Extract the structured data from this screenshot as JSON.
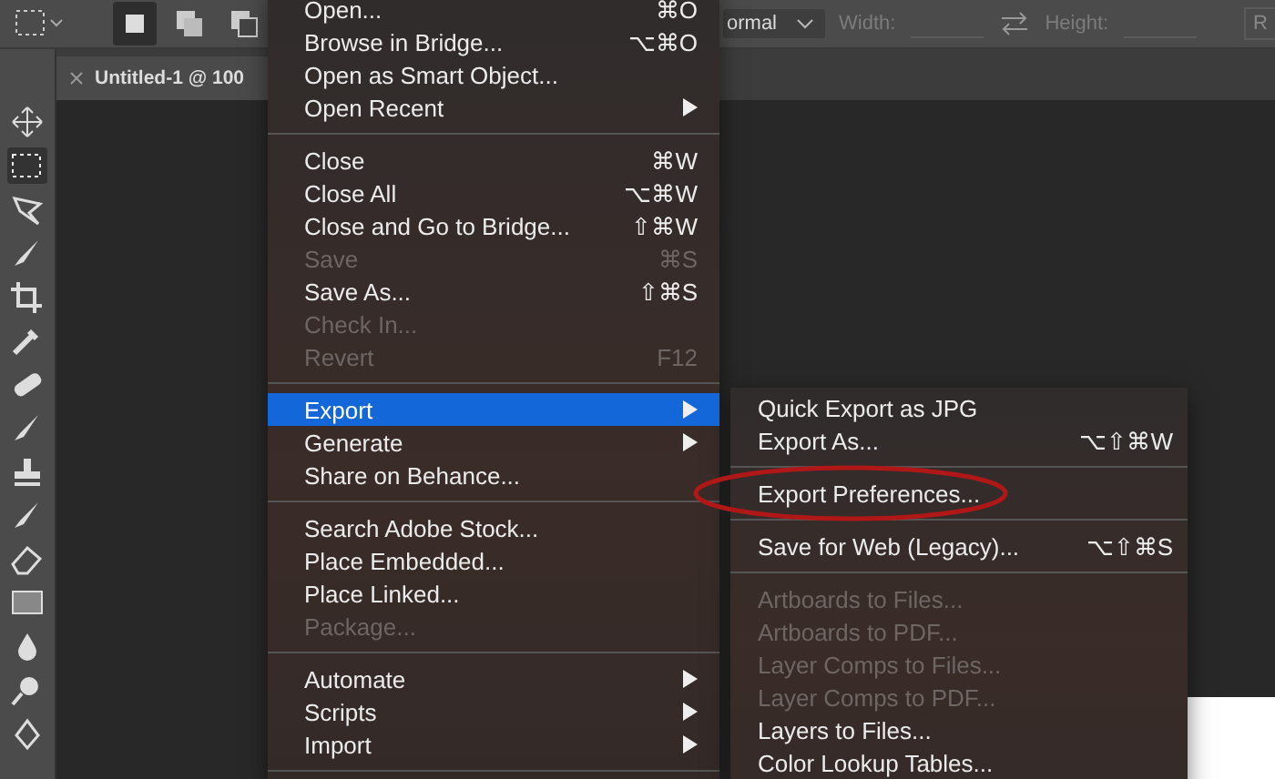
{
  "options_bar": {
    "mode": "ormal",
    "width_label": "Width:",
    "height_label": "Height:",
    "field_cut": "R"
  },
  "document_tab": {
    "title": "Untitled-1 @ 100"
  },
  "file_menu": {
    "items": [
      {
        "kind": "item",
        "label": "Open...",
        "shortcut": "⌘O",
        "disabled": false,
        "submenu": false,
        "selected": false
      },
      {
        "kind": "item",
        "label": "Browse in Bridge...",
        "shortcut": "⌥⌘O",
        "disabled": false,
        "submenu": false,
        "selected": false
      },
      {
        "kind": "item",
        "label": "Open as Smart Object...",
        "disabled": false,
        "submenu": false,
        "selected": false
      },
      {
        "kind": "item",
        "label": "Open Recent",
        "disabled": false,
        "submenu": true,
        "selected": false
      },
      {
        "kind": "separator"
      },
      {
        "kind": "item",
        "label": "Close",
        "shortcut": "⌘W",
        "disabled": false,
        "submenu": false,
        "selected": false
      },
      {
        "kind": "item",
        "label": "Close All",
        "shortcut": "⌥⌘W",
        "disabled": false,
        "submenu": false,
        "selected": false
      },
      {
        "kind": "item",
        "label": "Close and Go to Bridge...",
        "shortcut": "⇧⌘W",
        "disabled": false,
        "submenu": false,
        "selected": false
      },
      {
        "kind": "item",
        "label": "Save",
        "shortcut": "⌘S",
        "disabled": true,
        "submenu": false,
        "selected": false
      },
      {
        "kind": "item",
        "label": "Save As...",
        "shortcut": "⇧⌘S",
        "disabled": false,
        "submenu": false,
        "selected": false
      },
      {
        "kind": "item",
        "label": "Check In...",
        "disabled": true,
        "submenu": false,
        "selected": false
      },
      {
        "kind": "item",
        "label": "Revert",
        "shortcut": "F12",
        "disabled": true,
        "submenu": false,
        "selected": false
      },
      {
        "kind": "separator"
      },
      {
        "kind": "item",
        "label": "Export",
        "disabled": false,
        "submenu": true,
        "selected": true
      },
      {
        "kind": "item",
        "label": "Generate",
        "disabled": false,
        "submenu": true,
        "selected": false
      },
      {
        "kind": "item",
        "label": "Share on Behance...",
        "disabled": false,
        "submenu": false,
        "selected": false
      },
      {
        "kind": "separator"
      },
      {
        "kind": "item",
        "label": "Search Adobe Stock...",
        "disabled": false,
        "submenu": false,
        "selected": false
      },
      {
        "kind": "item",
        "label": "Place Embedded...",
        "disabled": false,
        "submenu": false,
        "selected": false
      },
      {
        "kind": "item",
        "label": "Place Linked...",
        "disabled": false,
        "submenu": false,
        "selected": false
      },
      {
        "kind": "item",
        "label": "Package...",
        "disabled": true,
        "submenu": false,
        "selected": false
      },
      {
        "kind": "separator"
      },
      {
        "kind": "item",
        "label": "Automate",
        "disabled": false,
        "submenu": true,
        "selected": false
      },
      {
        "kind": "item",
        "label": "Scripts",
        "disabled": false,
        "submenu": true,
        "selected": false
      },
      {
        "kind": "item",
        "label": "Import",
        "disabled": false,
        "submenu": true,
        "selected": false
      },
      {
        "kind": "separator"
      }
    ]
  },
  "export_submenu": {
    "items": [
      {
        "kind": "item",
        "label": "Quick Export as JPG",
        "disabled": false,
        "circled": false
      },
      {
        "kind": "item",
        "label": "Export As...",
        "shortcut": "⌥⇧⌘W",
        "disabled": false,
        "circled": false
      },
      {
        "kind": "separator"
      },
      {
        "kind": "item",
        "label": "Export Preferences...",
        "disabled": false,
        "circled": true
      },
      {
        "kind": "separator"
      },
      {
        "kind": "item",
        "label": "Save for Web (Legacy)...",
        "shortcut": "⌥⇧⌘S",
        "disabled": false,
        "circled": false
      },
      {
        "kind": "separator"
      },
      {
        "kind": "item",
        "label": "Artboards to Files...",
        "disabled": true,
        "circled": false
      },
      {
        "kind": "item",
        "label": "Artboards to PDF...",
        "disabled": true,
        "circled": false
      },
      {
        "kind": "item",
        "label": "Layer Comps to Files...",
        "disabled": true,
        "circled": false
      },
      {
        "kind": "item",
        "label": "Layer Comps to PDF...",
        "disabled": true,
        "circled": false
      },
      {
        "kind": "item",
        "label": "Layers to Files...",
        "disabled": false,
        "circled": false
      },
      {
        "kind": "item",
        "label": "Color Lookup Tables...",
        "disabled": false,
        "circled": false
      }
    ]
  }
}
